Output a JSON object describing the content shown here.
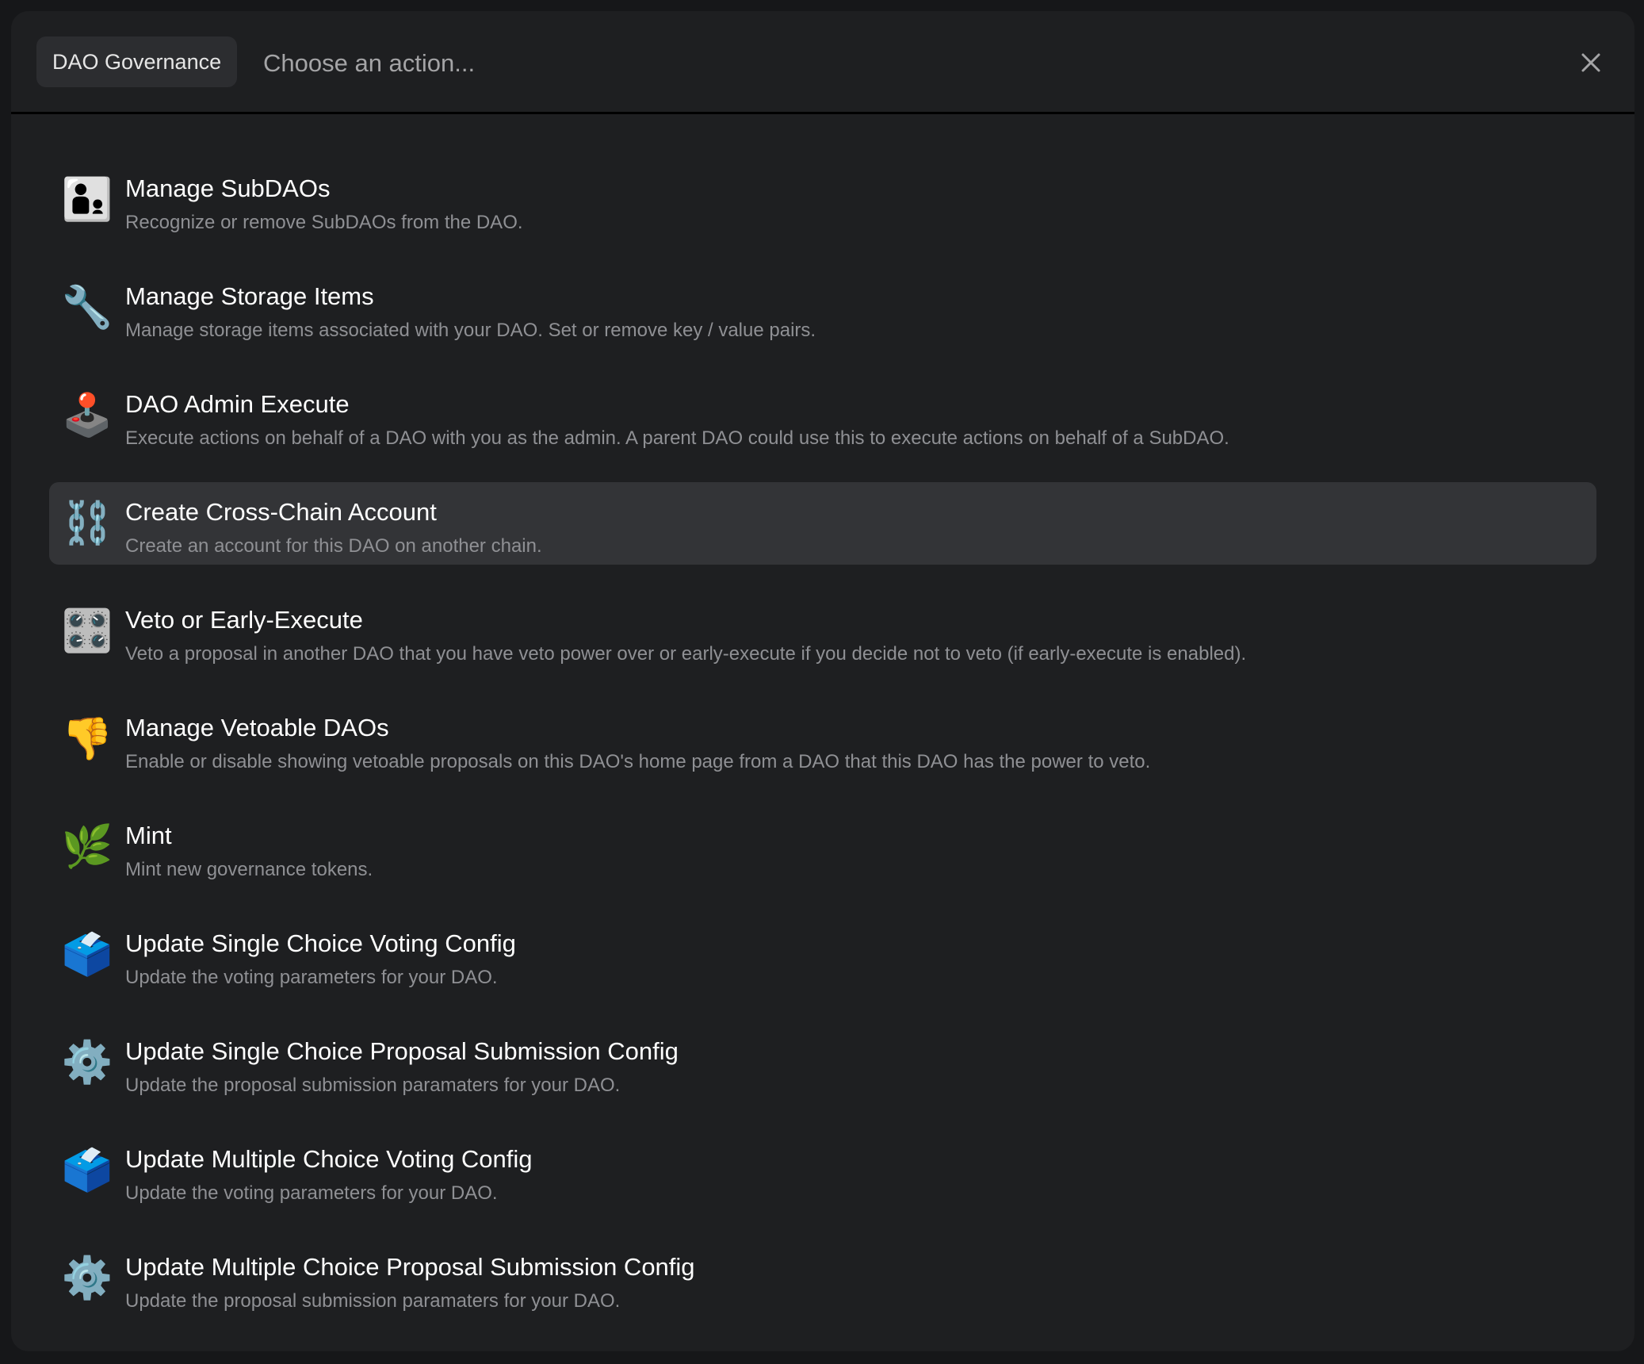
{
  "header": {
    "category_chip": "DAO Governance",
    "search_placeholder": "Choose an action...",
    "close_label": "Close"
  },
  "actions": [
    {
      "icon": "👨‍👦",
      "icon_name": "man-and-boy-icon",
      "title": "Manage SubDAOs",
      "description": "Recognize or remove SubDAOs from the DAO.",
      "active": false
    },
    {
      "icon": "🔧",
      "icon_name": "wrench-icon",
      "title": "Manage Storage Items",
      "description": "Manage storage items associated with your DAO. Set or remove key / value pairs.",
      "active": false
    },
    {
      "icon": "🕹️",
      "icon_name": "joystick-icon",
      "title": "DAO Admin Execute",
      "description": "Execute actions on behalf of a DAO with you as the admin. A parent DAO could use this to execute actions on behalf of a SubDAO.",
      "active": false
    },
    {
      "icon": "⛓️",
      "icon_name": "chains-icon",
      "title": "Create Cross-Chain Account",
      "description": "Create an account for this DAO on another chain.",
      "active": true
    },
    {
      "icon": "🎛️",
      "icon_name": "control-knobs-icon",
      "title": "Veto or Early-Execute",
      "description": "Veto a proposal in another DAO that you have veto power over or early-execute if you decide not to veto (if early-execute is enabled).",
      "active": false
    },
    {
      "icon": "👎",
      "icon_name": "thumbs-down-icon",
      "title": "Manage Vetoable DAOs",
      "description": "Enable or disable showing vetoable proposals on this DAO's home page from a DAO that this DAO has the power to veto.",
      "active": false
    },
    {
      "icon": "🌿",
      "icon_name": "herb-icon",
      "title": "Mint",
      "description": "Mint new governance tokens.",
      "active": false
    },
    {
      "icon": "🗳️",
      "icon_name": "ballot-box-icon",
      "title": "Update Single Choice Voting Config",
      "description": "Update the voting parameters for your DAO.",
      "active": false
    },
    {
      "icon": "⚙️",
      "icon_name": "gear-icon",
      "title": "Update Single Choice Proposal Submission Config",
      "description": "Update the proposal submission paramaters for your DAO.",
      "active": false
    },
    {
      "icon": "🗳️",
      "icon_name": "ballot-box-icon",
      "title": "Update Multiple Choice Voting Config",
      "description": "Update the voting parameters for your DAO.",
      "active": false
    },
    {
      "icon": "⚙️",
      "icon_name": "gear-icon",
      "title": "Update Multiple Choice Proposal Submission Config",
      "description": "Update the proposal submission paramaters for your DAO.",
      "active": false
    }
  ]
}
